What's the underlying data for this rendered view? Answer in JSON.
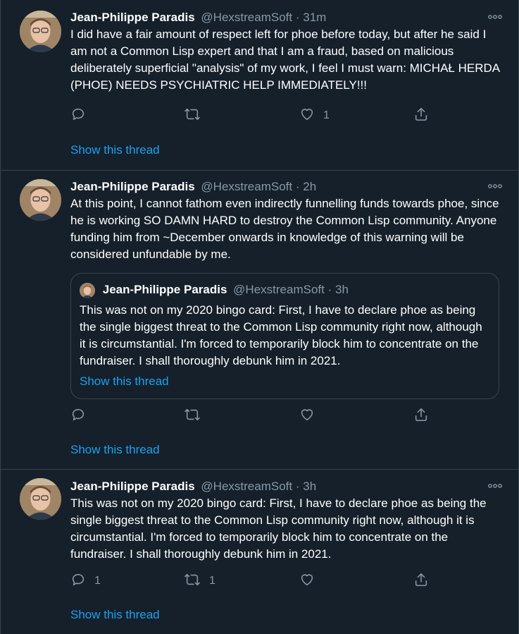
{
  "colors": {
    "background": "#15202b",
    "border": "#38444d",
    "secondary_text": "#8899a6",
    "link": "#1da1f2"
  },
  "tweets": [
    {
      "name": "Jean-Philippe Paradis",
      "handle": "@HexstreamSoft",
      "dot": "·",
      "time": "31m",
      "text": "I did have a fair amount of respect left for phoe before today, but after he said I am not a Common Lisp expert and that I am a fraud, based on malicious deliberately superficial \"analysis\" of my work, I feel I must warn: MICHAŁ HERDA (PHOE) NEEDS PSYCHIATRIC HELP IMMEDIATELY!!!",
      "reply_count": "",
      "retweet_count": "",
      "like_count": "1",
      "show_thread": "Show this thread"
    },
    {
      "name": "Jean-Philippe Paradis",
      "handle": "@HexstreamSoft",
      "dot": "·",
      "time": "2h",
      "text": "At this point, I cannot fathom even indirectly funnelling funds towards phoe, since he is working SO DAMN HARD to destroy the Common Lisp community. Anyone funding him from ~December onwards in knowledge of this warning will be considered unfundable by me.",
      "quote": {
        "name": "Jean-Philippe Paradis",
        "handle": "@HexstreamSoft",
        "dot": "·",
        "time": "3h",
        "text": "This was not on my 2020 bingo card: First, I have to declare phoe as being the single biggest threat to the Common Lisp community right now, although it is circumstantial. I'm forced to temporarily block him to concentrate on the fundraiser. I shall thoroughly debunk him in 2021.",
        "show_thread": "Show this thread"
      },
      "reply_count": "",
      "retweet_count": "",
      "like_count": "",
      "show_thread": "Show this thread"
    },
    {
      "name": "Jean-Philippe Paradis",
      "handle": "@HexstreamSoft",
      "dot": "·",
      "time": "3h",
      "text": "This was not on my 2020 bingo card: First, I have to declare phoe as being the single biggest threat to the Common Lisp community right now, although it is circumstantial. I'm forced to temporarily block him to concentrate on the fundraiser. I shall thoroughly debunk him in 2021.",
      "reply_count": "1",
      "retweet_count": "1",
      "like_count": "",
      "show_thread": "Show this thread"
    }
  ],
  "icons": {
    "more": "more-horizontal-icon",
    "reply": "reply-icon",
    "retweet": "retweet-icon",
    "like": "heart-icon",
    "share": "share-icon"
  }
}
